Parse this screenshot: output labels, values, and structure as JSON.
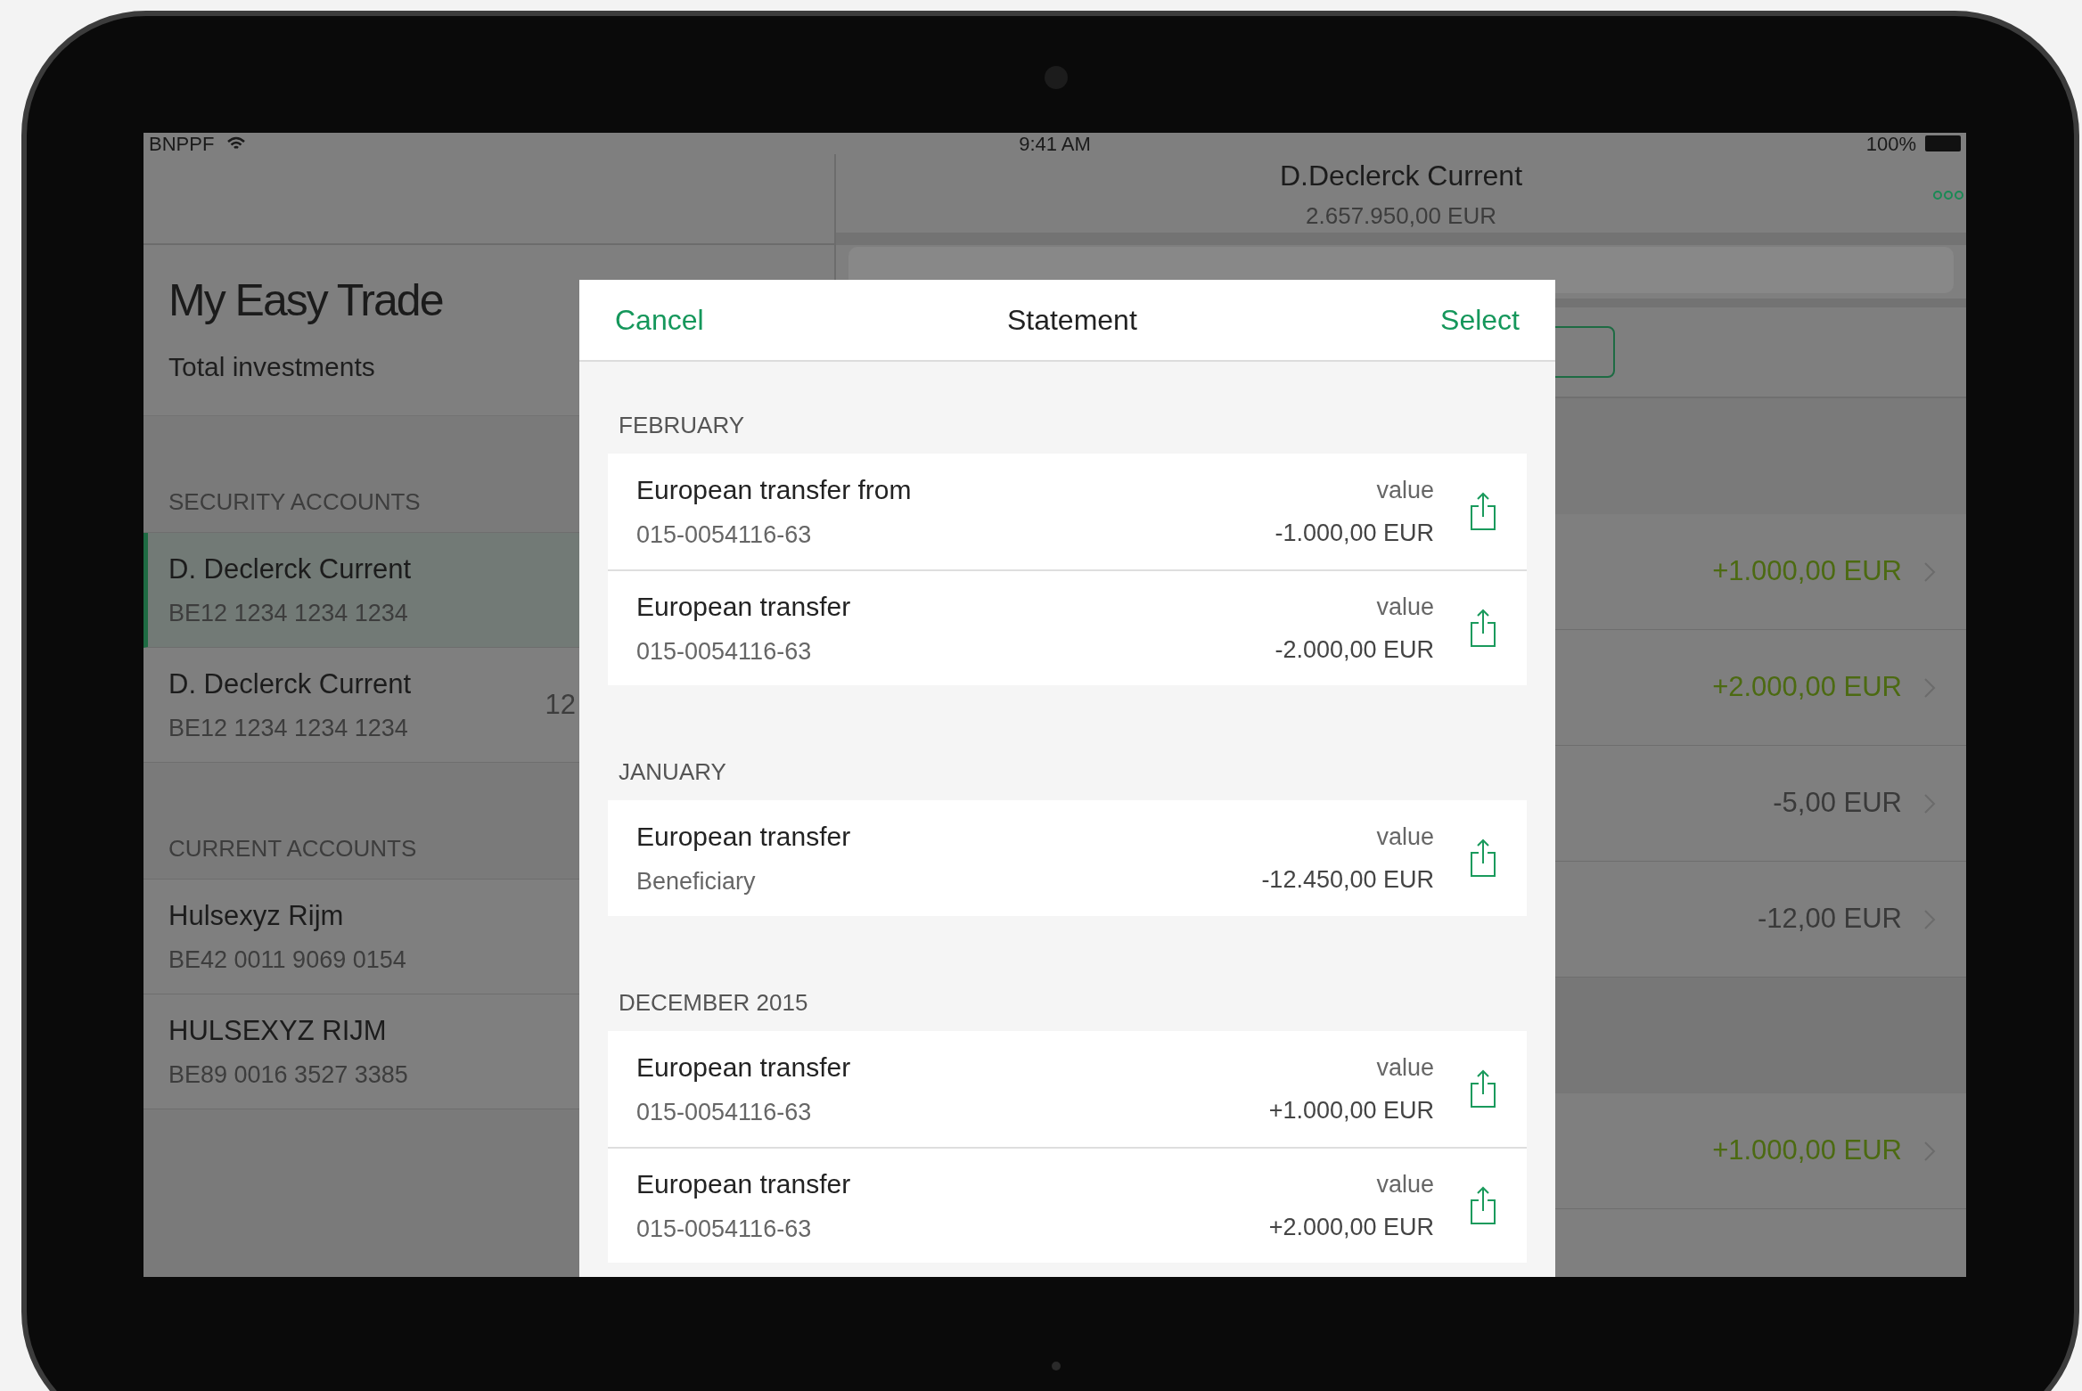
{
  "status_bar": {
    "carrier": "BNPPF",
    "time": "9:41 AM",
    "battery": "100%"
  },
  "sidebar": {
    "title": "My Easy Trade",
    "subtitle": "Total investments",
    "sections": [
      {
        "header": "SECURITY ACCOUNTS",
        "items": [
          {
            "name": "D. Declerck Current",
            "iban": "BE12 1234 1234 1234",
            "selected": true
          },
          {
            "name": "D. Declerck Current",
            "iban": "BE12 1234 1234 1234",
            "selected": false,
            "balance": "12"
          }
        ]
      },
      {
        "header": "CURRENT ACCOUNTS",
        "items": [
          {
            "name": "Hulsexyz Rijm",
            "iban": "BE42 0011 9069 0154",
            "selected": false
          },
          {
            "name": "HULSEXYZ RIJM",
            "iban": "BE89 0016 3527 3385",
            "selected": false
          }
        ]
      }
    ]
  },
  "account_detail": {
    "title": "D.Declerck Current",
    "balance": "2.657.950,00 EUR",
    "groups": [
      [
        {
          "amount": "+1.000,00 EUR",
          "kind": "credit"
        },
        {
          "amount": "+2.000,00 EUR",
          "kind": "credit"
        },
        {
          "amount": "-5,00 EUR",
          "kind": "debit"
        },
        {
          "amount": "-12,00 EUR",
          "kind": "debit"
        }
      ],
      [
        {
          "amount": "+1.000,00 EUR",
          "kind": "credit"
        }
      ]
    ]
  },
  "statement_sheet": {
    "cancel": "Cancel",
    "title": "Statement",
    "select": "Select",
    "sections": [
      {
        "header": "FEBRUARY",
        "items": [
          {
            "title": "European transfer from",
            "subtitle": "015-0054116-63",
            "label": "value",
            "amount": "-1.000,00 EUR"
          },
          {
            "title": "European transfer",
            "subtitle": "015-0054116-63",
            "label": "value",
            "amount": "-2.000,00 EUR"
          }
        ]
      },
      {
        "header": "JANUARY",
        "items": [
          {
            "title": "European transfer",
            "subtitle": "Beneficiary",
            "label": "value",
            "amount": "-12.450,00 EUR"
          }
        ]
      },
      {
        "header": "DECEMBER 2015",
        "items": [
          {
            "title": "European transfer",
            "subtitle": "015-0054116-63",
            "label": "value",
            "amount": "+1.000,00 EUR"
          },
          {
            "title": "European transfer",
            "subtitle": "015-0054116-63",
            "label": "value",
            "amount": "+2.000,00 EUR"
          }
        ]
      }
    ]
  }
}
